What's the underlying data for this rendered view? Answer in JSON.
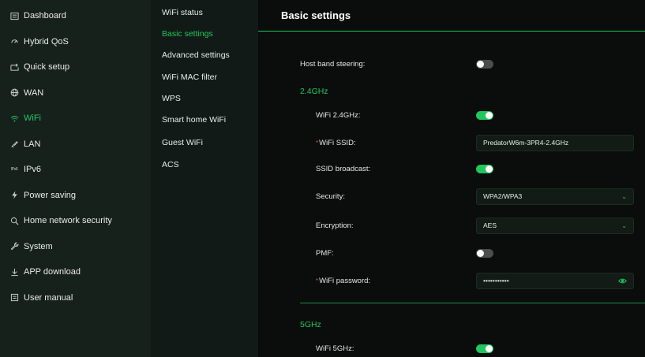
{
  "sidebar": {
    "items": [
      {
        "label": "Dashboard",
        "icon": "dashboard-icon"
      },
      {
        "label": "Hybrid QoS",
        "icon": "qos-icon"
      },
      {
        "label": "Quick setup",
        "icon": "quick-setup-icon"
      },
      {
        "label": "WAN",
        "icon": "globe-icon"
      },
      {
        "label": "WiFi",
        "icon": "wifi-icon",
        "active": true
      },
      {
        "label": "LAN",
        "icon": "lan-icon"
      },
      {
        "label": "IPv6",
        "icon": "ipv6-icon"
      },
      {
        "label": "Power saving",
        "icon": "lightning-icon"
      },
      {
        "label": "Home network security",
        "icon": "security-icon"
      },
      {
        "label": "System",
        "icon": "wrench-icon"
      },
      {
        "label": "APP download",
        "icon": "download-icon"
      },
      {
        "label": "User manual",
        "icon": "manual-icon"
      }
    ]
  },
  "submenu": {
    "items": [
      {
        "label": "WiFi status"
      },
      {
        "label": "Basic settings",
        "active": true
      },
      {
        "label": "Advanced settings"
      },
      {
        "label": "WiFi MAC filter"
      },
      {
        "label": "WPS"
      },
      {
        "label": "Smart home WiFi"
      },
      {
        "label": "Guest WiFi"
      },
      {
        "label": "ACS"
      }
    ]
  },
  "main": {
    "title": "Basic settings",
    "host_band_steering": {
      "label": "Host band steering:",
      "on": false
    },
    "band_24": {
      "section": "2.4GHz",
      "wifi_label": "WiFi 2.4GHz:",
      "wifi_on": true,
      "ssid_label": "WiFi SSID:",
      "ssid_value": "PredatorW6m-3PR4-2.4GHz",
      "broadcast_label": "SSID broadcast:",
      "broadcast_on": true,
      "security_label": "Security:",
      "security_value": "WPA2/WPA3",
      "encryption_label": "Encryption:",
      "encryption_value": "AES",
      "pmf_label": "PMF:",
      "pmf_on": false,
      "password_label": "WiFi password:",
      "password_value": "•••••••••••"
    },
    "band_5": {
      "section": "5GHz",
      "wifi_label": "WiFi 5GHz:",
      "wifi_on": true
    }
  },
  "colors": {
    "accent": "#22c55e",
    "sidebar_bg": "#16211c",
    "submenu_bg": "#111a16",
    "main_bg": "#0a0d0b"
  }
}
